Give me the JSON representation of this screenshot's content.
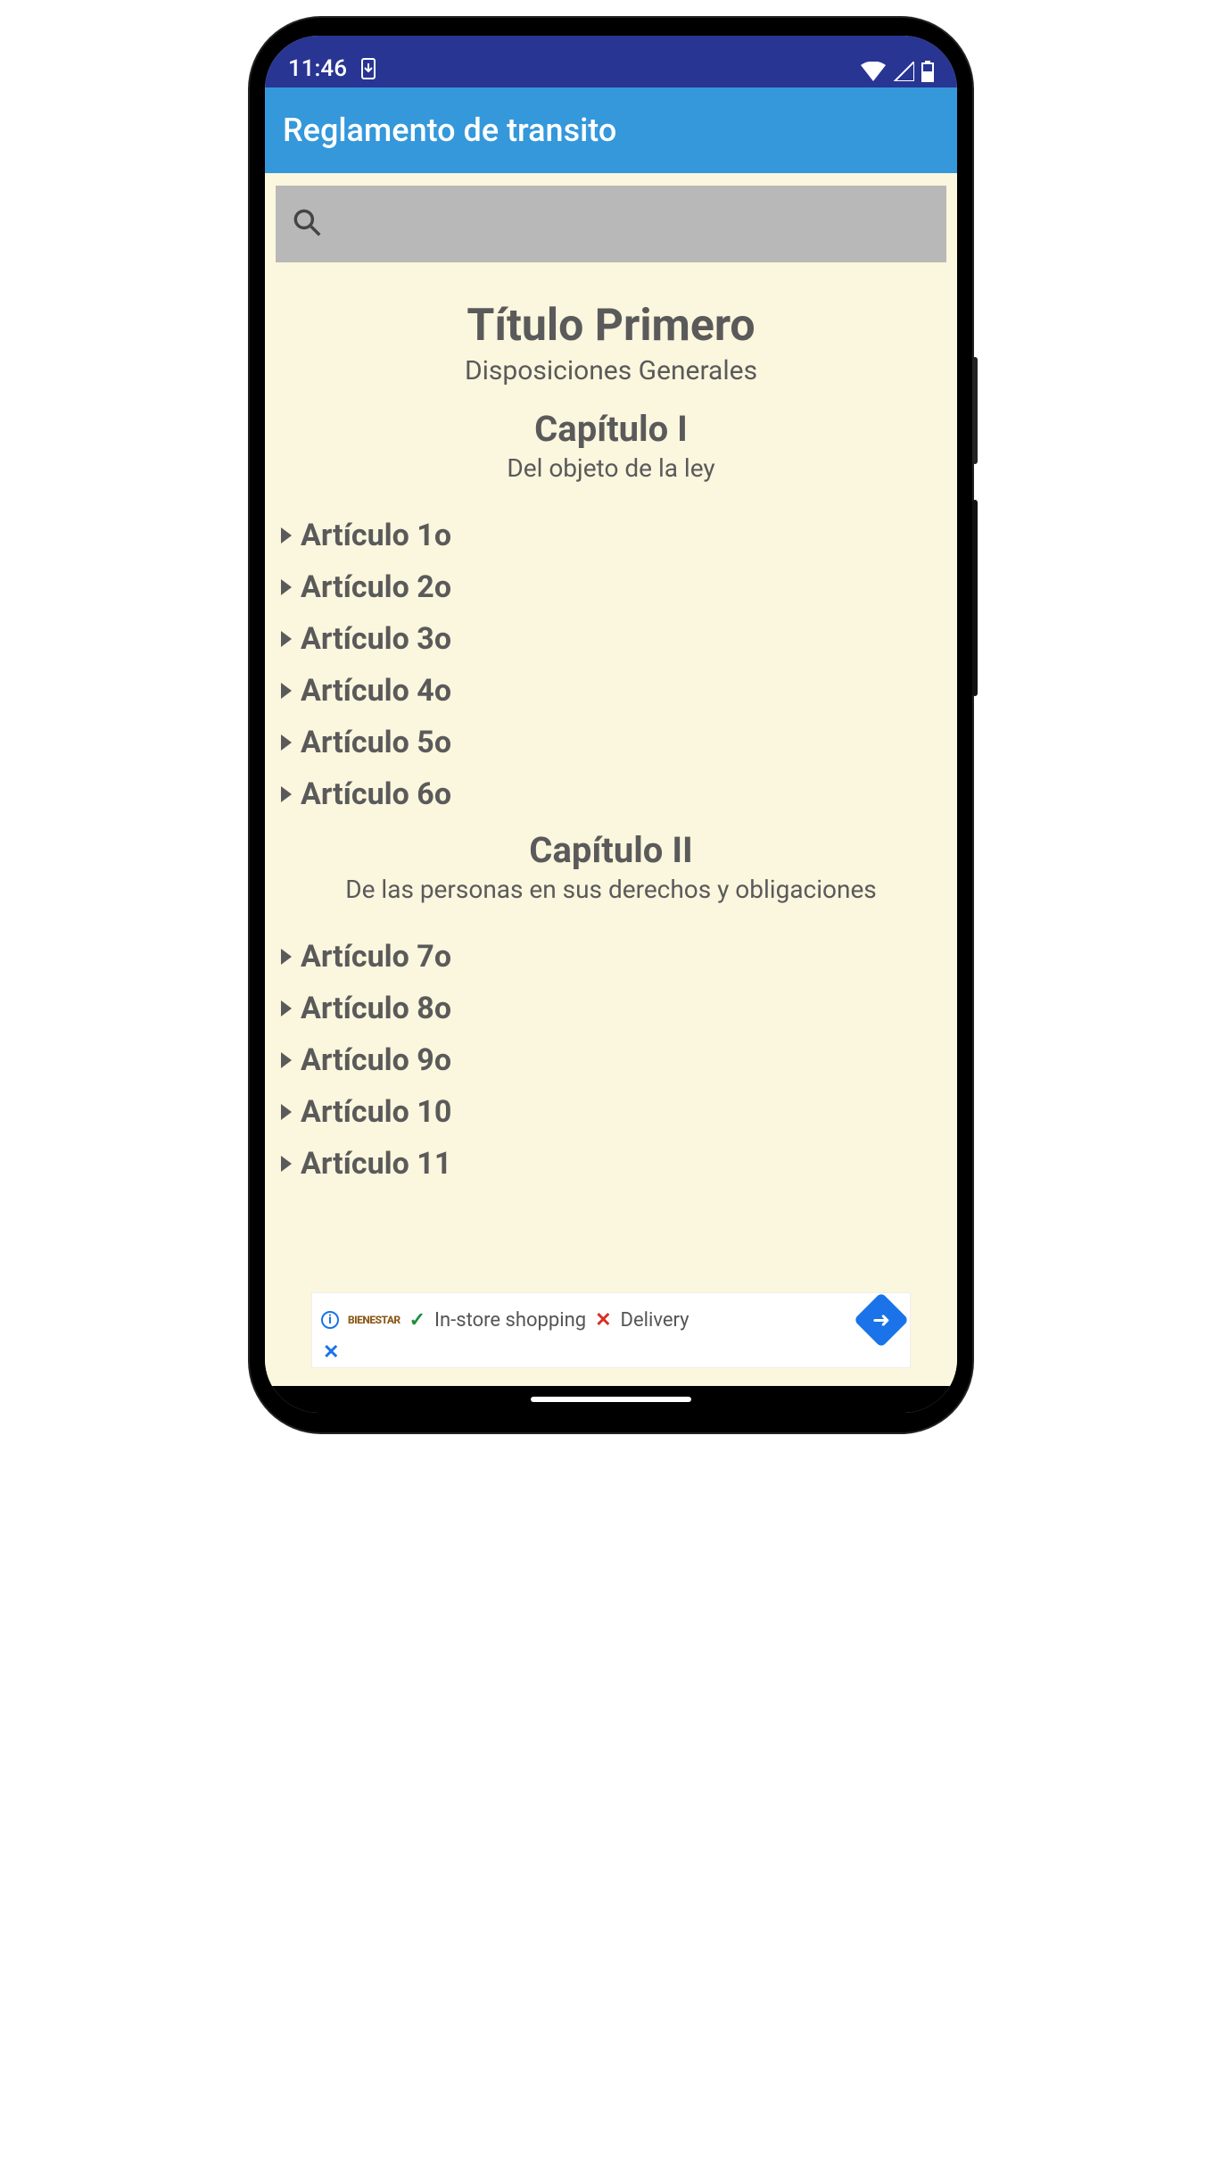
{
  "statusbar": {
    "time": "11:46"
  },
  "appbar": {
    "title": "Reglamento de transito"
  },
  "search": {
    "placeholder": ""
  },
  "titulo": {
    "heading": "Título Primero",
    "subheading": "Disposiciones Generales"
  },
  "capitulos": [
    {
      "heading": "Capítulo I",
      "subheading": "Del objeto de la ley",
      "articulos": [
        "Artículo 1o",
        "Artículo 2o",
        "Artículo 3o",
        "Artículo 4o",
        "Artículo 5o",
        "Artículo 6o"
      ]
    },
    {
      "heading": "Capítulo II",
      "subheading": "De las personas en sus derechos y obligaciones",
      "articulos": [
        "Artículo 7o",
        "Artículo 8o",
        "Artículo 9o",
        "Artículo 10",
        "Artículo 11"
      ]
    }
  ],
  "ad": {
    "brand": "BIENESTAR",
    "instore": "In-store shopping",
    "delivery": "Delivery"
  }
}
